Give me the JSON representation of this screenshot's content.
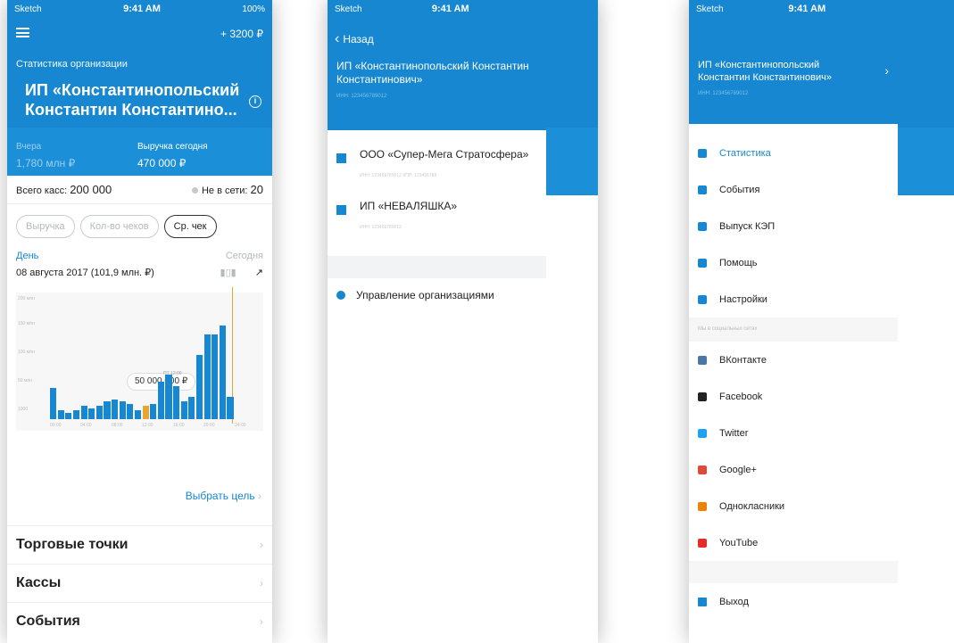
{
  "status": {
    "carrier": "Sketch",
    "time": "9:41 AM",
    "battery": "100%"
  },
  "phone1": {
    "balance": "+ 3200 ₽",
    "section_title": "Статистика организации",
    "org_name": "ИП «Константинопольский Константин Константино...",
    "yesterday_label": "Вчера",
    "yesterday_value": "1,780 млн ₽",
    "today_label": "Выручка сегодня",
    "today_value": "470 000 ₽",
    "total_label": "Всего касс:",
    "total_value": "200 000",
    "offline_label": "Не в сети:",
    "offline_value": "20",
    "pills": [
      "Выручка",
      "Кол-во чеков",
      "Ср. чек"
    ],
    "day_label": "День",
    "today_short": "Сегодня",
    "date_label": "08 августа 2017 (101,9 млн. ₽)",
    "y_ticks": [
      "200 млн",
      "150 млн",
      "100 млн",
      "50 млн",
      "1000"
    ],
    "x_ticks": [
      "00:00",
      "04:00",
      "08:00",
      "12:00",
      "16:00",
      "20:00",
      "24:00"
    ],
    "tooltip_time": "ПТ 12:00",
    "tooltip_value": "50 000 000 ₽",
    "choose_goal": "Выбрать цель",
    "rows": [
      "Торговые точки",
      "Кассы",
      "События"
    ],
    "accent": "#1687d0",
    "cursor_color": "#e8a62c"
  },
  "chart_data": {
    "type": "bar",
    "title": "",
    "x": [
      "00:00",
      "01:00",
      "02:00",
      "03:00",
      "04:00",
      "05:00",
      "06:00",
      "07:00",
      "08:00",
      "09:00",
      "10:00",
      "11:00",
      "12:00",
      "13:00",
      "14:00",
      "15:00",
      "16:00",
      "17:00",
      "18:00",
      "19:00",
      "20:00",
      "21:00",
      "22:00",
      "23:00"
    ],
    "values": [
      70,
      20,
      15,
      20,
      30,
      25,
      30,
      40,
      45,
      40,
      35,
      20,
      30,
      35,
      85,
      100,
      75,
      40,
      50,
      145,
      190,
      190,
      210,
      50
    ],
    "highlight_index": 12,
    "ylim": [
      0,
      250
    ],
    "grid": true
  },
  "phone2": {
    "back_label": "Назад",
    "org_title": "ИП «Константинопольский Константин Константинович»",
    "inn": "ИНН: 123456789012",
    "orgs": [
      {
        "name": "ООО «Супер-Мега Стратосфера»",
        "meta": "ИНН: 123456789012    КПП: 123456789"
      },
      {
        "name": "ИП «НЕВАЛЯШКА»",
        "meta": "ИНН: 123456789012"
      }
    ],
    "manage_label": "Управление организациями"
  },
  "phone3": {
    "org_title": "ИП «Константинопольский Константин Константинович»",
    "inn": "ИНН: 123456789012",
    "menu": [
      {
        "label": "Статистика",
        "icon": "bar-chart-icon",
        "color": "#1687d0",
        "active": true
      },
      {
        "label": "События",
        "icon": "calendar-icon",
        "color": "#1687d0",
        "active": false
      },
      {
        "label": "Выпуск КЭП",
        "icon": "pen-icon",
        "color": "#1687d0",
        "active": false
      },
      {
        "label": "Помощь",
        "icon": "lifebuoy-icon",
        "color": "#1687d0",
        "active": false
      },
      {
        "label": "Настройки",
        "icon": "gear-icon",
        "color": "#1687d0",
        "active": false
      }
    ],
    "social_title": "Мы в социальных сетях",
    "social": [
      {
        "label": "ВКонтакте",
        "icon": "vk-icon",
        "color": "#4a76a8"
      },
      {
        "label": "Facebook",
        "icon": "facebook-icon",
        "color": "#222222"
      },
      {
        "label": "Twitter",
        "icon": "twitter-icon",
        "color": "#1da1f2"
      },
      {
        "label": "Google+",
        "icon": "google-plus-icon",
        "color": "#dd4b39"
      },
      {
        "label": "Однокласники",
        "icon": "odnoklassniki-icon",
        "color": "#ee8208"
      },
      {
        "label": "YouTube",
        "icon": "youtube-icon",
        "color": "#e52d27"
      }
    ],
    "logout_label": "Выход"
  }
}
